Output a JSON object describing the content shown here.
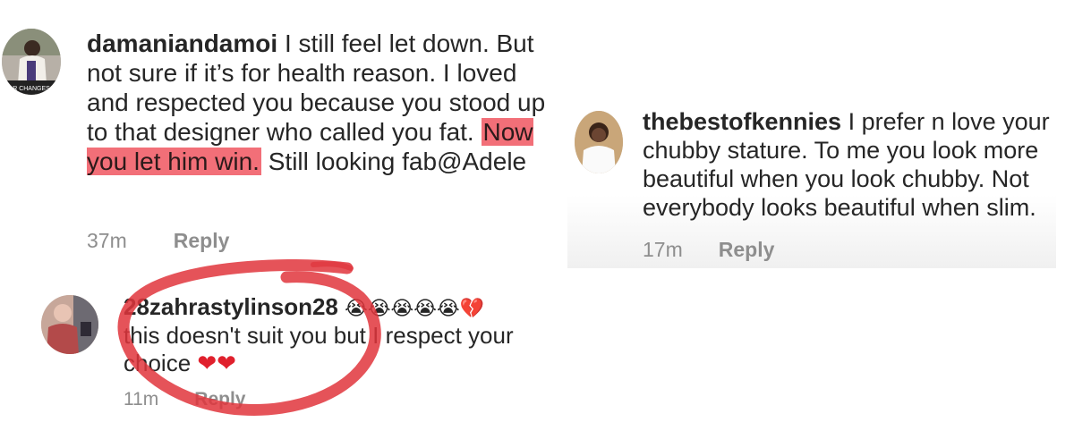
{
  "comment1": {
    "username": "damaniandamoi",
    "text_before": " I still feel let down. But not sure if it’s for health reason.  I loved and respected you because you stood up to that designer who called you fat. ",
    "text_highlight": "Now you let him win.",
    "text_after": "  Still looking fab@Adele",
    "time": "37m",
    "reply_label": "Reply",
    "avatar_caption": "R CHANGES"
  },
  "reply1": {
    "username": "28zahrastylinson28",
    "emojis": "😭😭😭😭😭💔",
    "text": "this doesn't suit you but I respect your choice ",
    "hearts": "❤❤",
    "time": "11m",
    "reply_label": "Reply"
  },
  "comment2": {
    "username": "thebestofkennies",
    "text": " I prefer n love your chubby stature. To me you look more beautiful when you look chubby. Not everybody looks beautiful when slim.",
    "time": "17m",
    "reply_label": "Reply"
  },
  "colors": {
    "highlight": "#f26f78",
    "annotation_circle": "#e0353c",
    "meta_text": "#8e8e8e"
  }
}
